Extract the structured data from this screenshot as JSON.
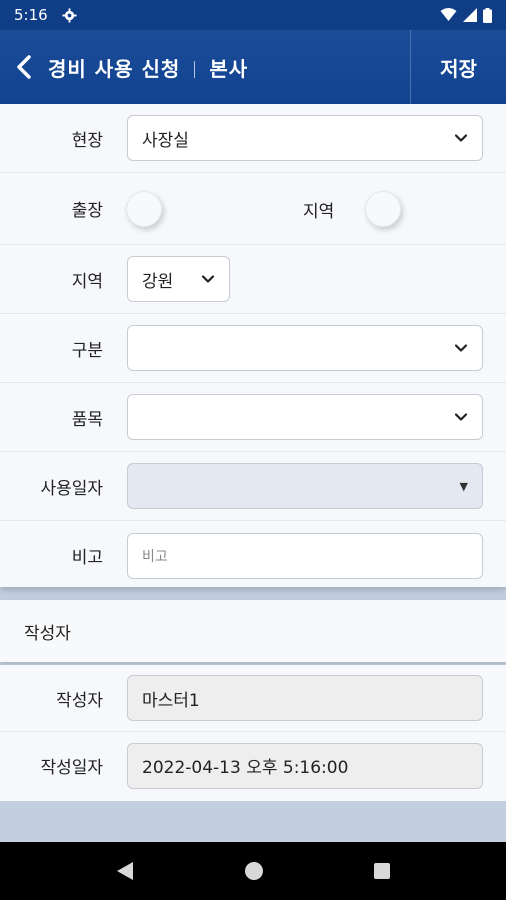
{
  "status_bar": {
    "time": "5:16"
  },
  "app_bar": {
    "title": "경비 사용 신청",
    "subtitle": "본사",
    "save_label": "저장"
  },
  "form": {
    "site": {
      "label": "현장",
      "value": "사장실"
    },
    "trip": {
      "label": "출장"
    },
    "region_radio": {
      "label": "지역"
    },
    "region": {
      "label": "지역",
      "value": "강원"
    },
    "category": {
      "label": "구분",
      "value": ""
    },
    "item": {
      "label": "품목",
      "value": ""
    },
    "use_date": {
      "label": "사용일자",
      "value": ""
    },
    "note": {
      "label": "비고",
      "placeholder": "비고"
    }
  },
  "writer_section": {
    "header": "작성자",
    "writer": {
      "label": "작성자",
      "value": "마스터1"
    },
    "written_date": {
      "label": "작성일자",
      "value": "2022-04-13 오후 5:16:00"
    }
  },
  "colors": {
    "app_bar": "#124391",
    "status_bar": "#0f3e86",
    "background": "#c3cfdf"
  }
}
